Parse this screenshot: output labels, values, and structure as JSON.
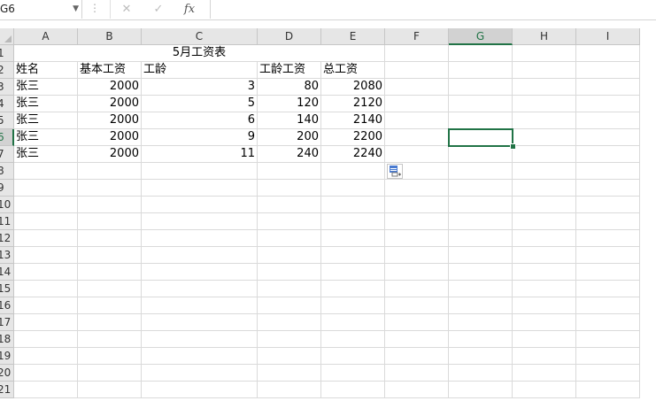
{
  "formula_bar": {
    "name_box": "G6",
    "cancel_icon": "✕",
    "enter_icon": "✓",
    "fx_label": "fx",
    "formula": ""
  },
  "columns": [
    "A",
    "B",
    "C",
    "D",
    "E",
    "F",
    "G",
    "H",
    "I"
  ],
  "rows": [
    "1",
    "2",
    "3",
    "4",
    "5",
    "6",
    "7",
    "8",
    "9",
    "10",
    "11",
    "12",
    "13",
    "14",
    "15",
    "16",
    "17",
    "18",
    "19",
    "20",
    "21"
  ],
  "sheet": {
    "title": "5月工资表",
    "headers": [
      "姓名",
      "基本工资",
      "工龄",
      "工龄工资",
      "总工资"
    ],
    "records": [
      [
        "张三",
        "2000",
        "3",
        "80",
        "2080"
      ],
      [
        "张三",
        "2000",
        "5",
        "120",
        "2120"
      ],
      [
        "张三",
        "2000",
        "6",
        "140",
        "2140"
      ],
      [
        "张三",
        "2000",
        "9",
        "200",
        "2200"
      ],
      [
        "张三",
        "2000",
        "11",
        "240",
        "2240"
      ]
    ]
  },
  "selection": {
    "cell": "G6"
  },
  "colors": {
    "accent": "#217346"
  }
}
